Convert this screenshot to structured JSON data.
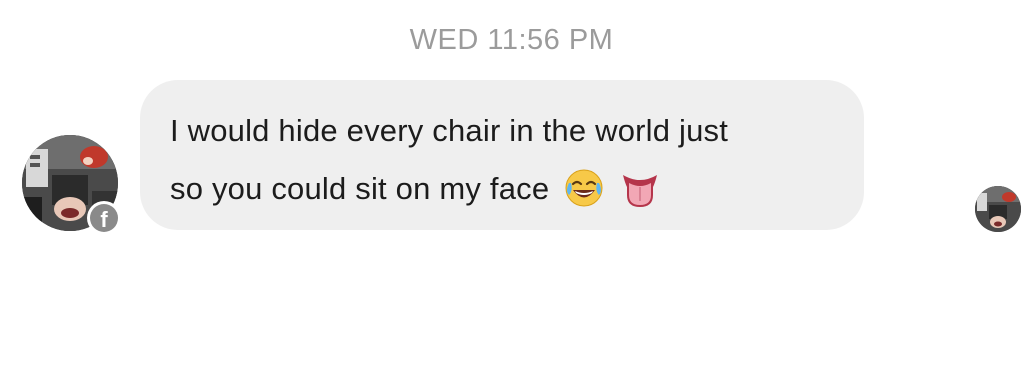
{
  "thread": {
    "timestamp": "WED 11:56 PM"
  },
  "message": {
    "line1": "I would hide every chair in the world just",
    "line2": "so you could sit on my face",
    "emojis": [
      "face-with-tears-of-joy-icon",
      "tongue-icon"
    ]
  },
  "sender": {
    "avatar": "sender-avatar",
    "badge": "facebook-badge-icon",
    "badge_glyph": "f"
  },
  "read_receipt": {
    "avatar": "seen-avatar"
  },
  "colors": {
    "bubble": "#efefef",
    "timestamp": "#9b9b9b",
    "text": "#1c1c1c",
    "badge": "#8a8a8a"
  }
}
